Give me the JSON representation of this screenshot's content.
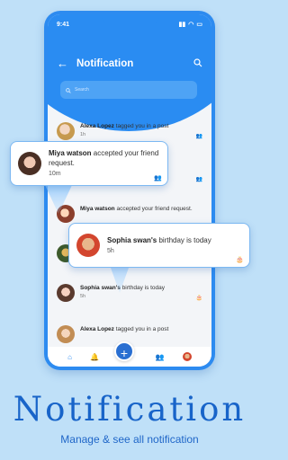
{
  "status_bar": {
    "time": "9:41"
  },
  "header": {
    "title": "Notification",
    "back_icon": "back-arrow-icon",
    "search_icon": "search-icon"
  },
  "search": {
    "placeholder": "Search"
  },
  "notifications": [
    {
      "name": "Alexa Lopez",
      "text": " tagged you in a post",
      "time": "1h",
      "icon": "users-icon"
    },
    {
      "name": "Miya watson",
      "text": " accepted your friend request.",
      "time": "",
      "icon": "users-icon"
    },
    {
      "name": "",
      "text": "",
      "time": "",
      "icon": ""
    },
    {
      "name": "Sophia swan's",
      "text": " birthday is today",
      "time": "5h",
      "icon": "cake-icon"
    },
    {
      "name": "Alexa Lopez",
      "text": " tagged you in a post",
      "time": "",
      "icon": ""
    }
  ],
  "popups": [
    {
      "name": "Miya watson",
      "text": " accepted your friend request.",
      "time": "10m",
      "icon": "users-icon"
    },
    {
      "name": "Sophia swan's",
      "text": " birthday is today",
      "time": "5h",
      "icon": "cake-icon"
    }
  ],
  "bottom_nav": {
    "fab_label": "+"
  },
  "promo": {
    "title": "Notification",
    "subtitle": "Manage & see all notification"
  },
  "colors": {
    "accent": "#2a8cf2",
    "background": "#bfe0f8",
    "title": "#1864c9"
  }
}
